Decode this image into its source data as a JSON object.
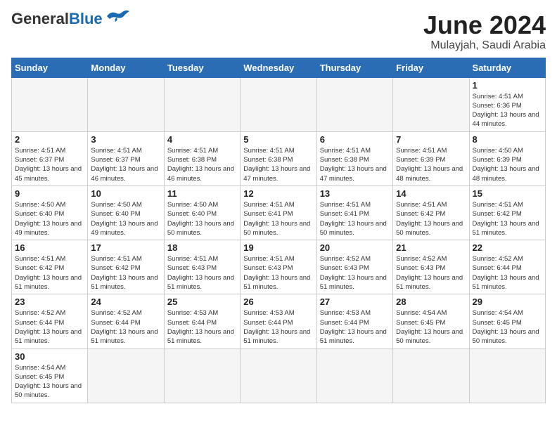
{
  "header": {
    "logo_general": "General",
    "logo_blue": "Blue",
    "title": "June 2024",
    "subtitle": "Mulayjah, Saudi Arabia"
  },
  "days_of_week": [
    "Sunday",
    "Monday",
    "Tuesday",
    "Wednesday",
    "Thursday",
    "Friday",
    "Saturday"
  ],
  "weeks": [
    [
      {
        "day": "",
        "empty": true
      },
      {
        "day": "",
        "empty": true
      },
      {
        "day": "",
        "empty": true
      },
      {
        "day": "",
        "empty": true
      },
      {
        "day": "",
        "empty": true
      },
      {
        "day": "",
        "empty": true
      },
      {
        "day": "1",
        "sunrise": "4:51 AM",
        "sunset": "6:36 PM",
        "daylight": "13 hours and 44 minutes."
      }
    ],
    [
      {
        "day": "2",
        "sunrise": "4:51 AM",
        "sunset": "6:37 PM",
        "daylight": "13 hours and 45 minutes."
      },
      {
        "day": "3",
        "sunrise": "4:51 AM",
        "sunset": "6:37 PM",
        "daylight": "13 hours and 46 minutes."
      },
      {
        "day": "4",
        "sunrise": "4:51 AM",
        "sunset": "6:38 PM",
        "daylight": "13 hours and 46 minutes."
      },
      {
        "day": "5",
        "sunrise": "4:51 AM",
        "sunset": "6:38 PM",
        "daylight": "13 hours and 47 minutes."
      },
      {
        "day": "6",
        "sunrise": "4:51 AM",
        "sunset": "6:38 PM",
        "daylight": "13 hours and 47 minutes."
      },
      {
        "day": "7",
        "sunrise": "4:51 AM",
        "sunset": "6:39 PM",
        "daylight": "13 hours and 48 minutes."
      },
      {
        "day": "8",
        "sunrise": "4:50 AM",
        "sunset": "6:39 PM",
        "daylight": "13 hours and 48 minutes."
      }
    ],
    [
      {
        "day": "9",
        "sunrise": "4:50 AM",
        "sunset": "6:40 PM",
        "daylight": "13 hours and 49 minutes."
      },
      {
        "day": "10",
        "sunrise": "4:50 AM",
        "sunset": "6:40 PM",
        "daylight": "13 hours and 49 minutes."
      },
      {
        "day": "11",
        "sunrise": "4:50 AM",
        "sunset": "6:40 PM",
        "daylight": "13 hours and 50 minutes."
      },
      {
        "day": "12",
        "sunrise": "4:51 AM",
        "sunset": "6:41 PM",
        "daylight": "13 hours and 50 minutes."
      },
      {
        "day": "13",
        "sunrise": "4:51 AM",
        "sunset": "6:41 PM",
        "daylight": "13 hours and 50 minutes."
      },
      {
        "day": "14",
        "sunrise": "4:51 AM",
        "sunset": "6:42 PM",
        "daylight": "13 hours and 50 minutes."
      },
      {
        "day": "15",
        "sunrise": "4:51 AM",
        "sunset": "6:42 PM",
        "daylight": "13 hours and 51 minutes."
      }
    ],
    [
      {
        "day": "16",
        "sunrise": "4:51 AM",
        "sunset": "6:42 PM",
        "daylight": "13 hours and 51 minutes."
      },
      {
        "day": "17",
        "sunrise": "4:51 AM",
        "sunset": "6:42 PM",
        "daylight": "13 hours and 51 minutes."
      },
      {
        "day": "18",
        "sunrise": "4:51 AM",
        "sunset": "6:43 PM",
        "daylight": "13 hours and 51 minutes."
      },
      {
        "day": "19",
        "sunrise": "4:51 AM",
        "sunset": "6:43 PM",
        "daylight": "13 hours and 51 minutes."
      },
      {
        "day": "20",
        "sunrise": "4:52 AM",
        "sunset": "6:43 PM",
        "daylight": "13 hours and 51 minutes."
      },
      {
        "day": "21",
        "sunrise": "4:52 AM",
        "sunset": "6:43 PM",
        "daylight": "13 hours and 51 minutes."
      },
      {
        "day": "22",
        "sunrise": "4:52 AM",
        "sunset": "6:44 PM",
        "daylight": "13 hours and 51 minutes."
      }
    ],
    [
      {
        "day": "23",
        "sunrise": "4:52 AM",
        "sunset": "6:44 PM",
        "daylight": "13 hours and 51 minutes."
      },
      {
        "day": "24",
        "sunrise": "4:52 AM",
        "sunset": "6:44 PM",
        "daylight": "13 hours and 51 minutes."
      },
      {
        "day": "25",
        "sunrise": "4:53 AM",
        "sunset": "6:44 PM",
        "daylight": "13 hours and 51 minutes."
      },
      {
        "day": "26",
        "sunrise": "4:53 AM",
        "sunset": "6:44 PM",
        "daylight": "13 hours and 51 minutes."
      },
      {
        "day": "27",
        "sunrise": "4:53 AM",
        "sunset": "6:44 PM",
        "daylight": "13 hours and 51 minutes."
      },
      {
        "day": "28",
        "sunrise": "4:54 AM",
        "sunset": "6:45 PM",
        "daylight": "13 hours and 50 minutes."
      },
      {
        "day": "29",
        "sunrise": "4:54 AM",
        "sunset": "6:45 PM",
        "daylight": "13 hours and 50 minutes."
      }
    ],
    [
      {
        "day": "30",
        "sunrise": "4:54 AM",
        "sunset": "6:45 PM",
        "daylight": "13 hours and 50 minutes."
      },
      {
        "day": "",
        "empty": true
      },
      {
        "day": "",
        "empty": true
      },
      {
        "day": "",
        "empty": true
      },
      {
        "day": "",
        "empty": true
      },
      {
        "day": "",
        "empty": true
      },
      {
        "day": "",
        "empty": true
      }
    ]
  ]
}
